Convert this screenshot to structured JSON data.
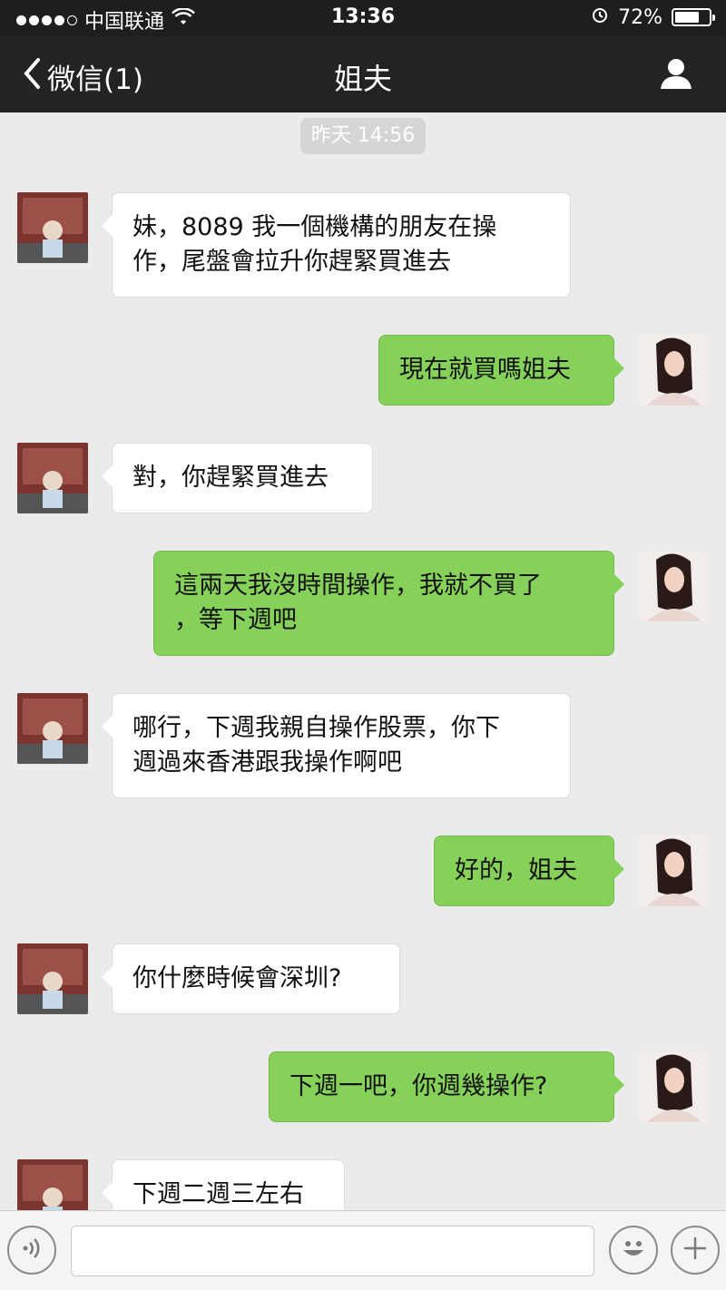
{
  "status_bar": {
    "carrier": "中国联通",
    "time": "13:36",
    "battery_percent": "72%",
    "battery_level": 0.72
  },
  "nav": {
    "back_label": "微信(1)",
    "title": "姐夫",
    "profile_icon": "person-icon"
  },
  "chat": {
    "timestamp": "昨天 14:56",
    "messages": [
      {
        "from": "contact",
        "text_lines": [
          "妹，8089 我一個機構的朋友在操",
          "作，尾盤會拉升你趕緊買進去"
        ]
      },
      {
        "from": "me",
        "text_lines": [
          "現在就買嗎姐夫"
        ]
      },
      {
        "from": "contact",
        "text_lines": [
          "對，你趕緊買進去"
        ]
      },
      {
        "from": "me",
        "text_lines": [
          "這兩天我沒時間操作，我就不買了",
          "，等下週吧"
        ]
      },
      {
        "from": "contact",
        "text_lines": [
          "哪行，下週我親自操作股票，你下",
          "週過來香港跟我操作啊吧"
        ]
      },
      {
        "from": "me",
        "text_lines": [
          "好的，姐夫"
        ]
      },
      {
        "from": "contact",
        "text_lines": [
          "你什麼時候會深圳?"
        ]
      },
      {
        "from": "me",
        "text_lines": [
          "下週一吧，你週幾操作?"
        ]
      },
      {
        "from": "contact",
        "text_lines": [
          "下週二週三左右"
        ]
      }
    ]
  },
  "input_bar": {
    "voice_icon": "voice-icon",
    "text_value": "",
    "emoji_icon": "emoji-icon",
    "add_icon": "plus-icon"
  },
  "colors": {
    "outgoing_bubble": "#86d15a",
    "incoming_bubble": "#ffffff",
    "nav_background": "#232323",
    "chat_background": "#ebebeb"
  }
}
